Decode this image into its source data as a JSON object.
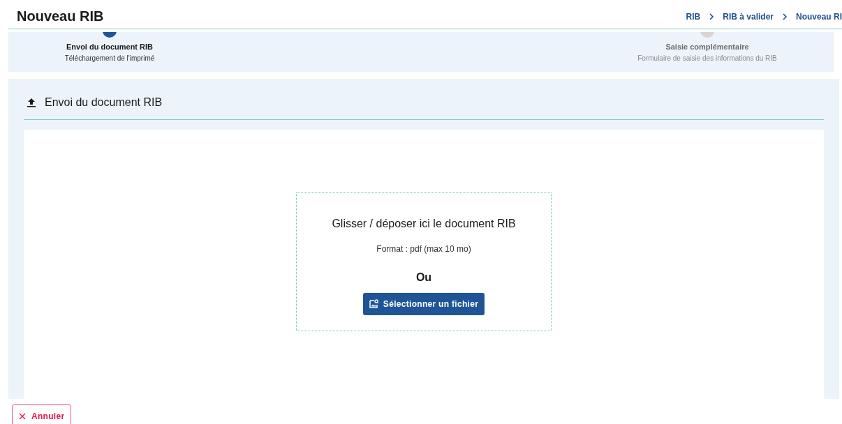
{
  "page": {
    "title": "Nouveau RIB"
  },
  "breadcrumb": [
    "RIB",
    "RIB à valider",
    "Nouveau RI"
  ],
  "steps": [
    {
      "title": "Envoi du document RIB",
      "subtitle": "Téléchargement de l'imprimé",
      "active": true
    },
    {
      "title": "Saisie complémentaire",
      "subtitle": "Formulaire de saisie des informations du RIB",
      "active": false
    }
  ],
  "section": {
    "title": "Envoi du document RIB"
  },
  "dropzone": {
    "title": "Glisser / déposer ici le document RIB",
    "format": "Format : pdf (max 10 mo)",
    "separator": "Ou",
    "button": "Sélectionner un fichier"
  },
  "cancel_button": "Annuler"
}
